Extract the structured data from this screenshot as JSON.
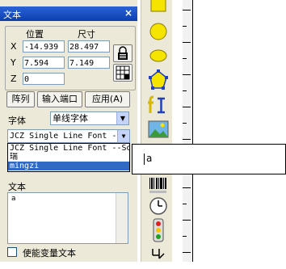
{
  "panel": {
    "title": "文本",
    "close_glyph": "×",
    "position_group": {
      "position_label": "位置",
      "size_label": "尺寸",
      "x_label": "X",
      "y_label": "Y",
      "z_label": "Z",
      "x_value": "-14.939",
      "y_value": "7.594",
      "z_value": "0",
      "width_value": "28.497",
      "height_value": "7.149"
    },
    "buttons": {
      "array": "阵列",
      "input_port": "输入端口",
      "apply": "应用(A)"
    },
    "font": {
      "label": "字体",
      "type_value": "单线字体",
      "font_value": "JCZ Single Line Font -",
      "options": [
        "JCZ Single Line Font --So",
        "瑞",
        "mingzi"
      ],
      "selected_option": "mingzi"
    },
    "text": {
      "label": "文本",
      "value": "a"
    },
    "variable_text": {
      "label": "使能变量文本"
    }
  },
  "float_edit": {
    "value": "a"
  },
  "toolbar": {
    "icons": [
      "rectangle-icon",
      "circle-icon",
      "ellipse-icon",
      "polygon-icon",
      "text-icon",
      "bitmap-icon",
      "vector-file-icon",
      "time-icon",
      "signal-light-icon",
      "barcode-icon"
    ]
  },
  "colors": {
    "title_bar": "#0b3fae",
    "panel_bg": "#ece9d8",
    "selection": "#316ac5",
    "shape_yellow": "#f5e400"
  }
}
